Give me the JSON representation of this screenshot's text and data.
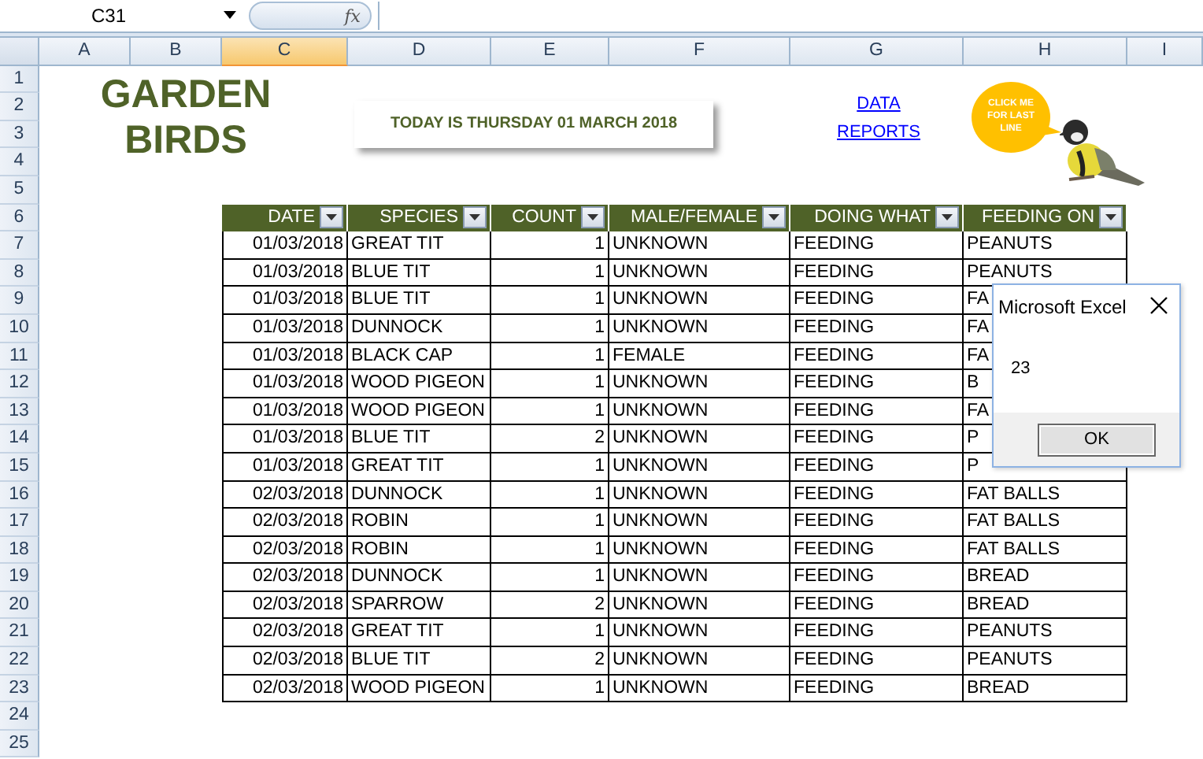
{
  "formula_bar": {
    "name_box": "C31",
    "function_icon": "fx"
  },
  "columns": [
    {
      "label": "A",
      "selected": false
    },
    {
      "label": "B",
      "selected": false
    },
    {
      "label": "C",
      "selected": true
    },
    {
      "label": "D",
      "selected": false
    },
    {
      "label": "E",
      "selected": false
    },
    {
      "label": "F",
      "selected": false
    },
    {
      "label": "G",
      "selected": false
    },
    {
      "label": "H",
      "selected": false
    },
    {
      "label": "I",
      "selected": false
    }
  ],
  "row_numbers": [
    "1",
    "2",
    "3",
    "4",
    "5",
    "6",
    "7",
    "8",
    "9",
    "10",
    "11",
    "12",
    "13",
    "14",
    "15",
    "16",
    "17",
    "18",
    "19",
    "20",
    "21",
    "22",
    "23",
    "24",
    "25"
  ],
  "title_lines": [
    "GARDEN",
    "BIRDS"
  ],
  "date_banner": "TODAY IS THURSDAY 01 MARCH 2018",
  "links": [
    "DATA",
    "REPORTS"
  ],
  "callout": "CLICK ME FOR LAST LINE",
  "table": {
    "columns": [
      "DATE",
      "SPECIES",
      "COUNT",
      "MALE/FEMALE",
      "DOING WHAT",
      "FEEDING ON"
    ],
    "rows": [
      [
        "01/03/2018",
        "GREAT TIT",
        "1",
        "UNKNOWN",
        "FEEDING",
        "PEANUTS"
      ],
      [
        "01/03/2018",
        "BLUE TIT",
        "1",
        "UNKNOWN",
        "FEEDING",
        "PEANUTS"
      ],
      [
        "01/03/2018",
        "BLUE TIT",
        "1",
        "UNKNOWN",
        "FEEDING",
        "FA"
      ],
      [
        "01/03/2018",
        "DUNNOCK",
        "1",
        "UNKNOWN",
        "FEEDING",
        "FA"
      ],
      [
        "01/03/2018",
        "BLACK CAP",
        "1",
        "FEMALE",
        "FEEDING",
        "FA"
      ],
      [
        "01/03/2018",
        "WOOD PIGEON",
        "1",
        "UNKNOWN",
        "FEEDING",
        "B"
      ],
      [
        "01/03/2018",
        "WOOD PIGEON",
        "1",
        "UNKNOWN",
        "FEEDING",
        "FA"
      ],
      [
        "01/03/2018",
        "BLUE TIT",
        "2",
        "UNKNOWN",
        "FEEDING",
        "P"
      ],
      [
        "01/03/2018",
        "GREAT TIT",
        "1",
        "UNKNOWN",
        "FEEDING",
        "P"
      ],
      [
        "02/03/2018",
        "DUNNOCK",
        "1",
        "UNKNOWN",
        "FEEDING",
        "FAT BALLS"
      ],
      [
        "02/03/2018",
        "ROBIN",
        "1",
        "UNKNOWN",
        "FEEDING",
        "FAT BALLS"
      ],
      [
        "02/03/2018",
        "ROBIN",
        "1",
        "UNKNOWN",
        "FEEDING",
        "FAT BALLS"
      ],
      [
        "02/03/2018",
        "DUNNOCK",
        "1",
        "UNKNOWN",
        "FEEDING",
        "BREAD"
      ],
      [
        "02/03/2018",
        "SPARROW",
        "2",
        "UNKNOWN",
        "FEEDING",
        "BREAD"
      ],
      [
        "02/03/2018",
        "GREAT TIT",
        "1",
        "UNKNOWN",
        "FEEDING",
        "PEANUTS"
      ],
      [
        "02/03/2018",
        "BLUE TIT",
        "2",
        "UNKNOWN",
        "FEEDING",
        "PEANUTS"
      ],
      [
        "02/03/2018",
        "WOOD PIGEON",
        "1",
        "UNKNOWN",
        "FEEDING",
        "BREAD"
      ]
    ]
  },
  "dialog": {
    "title": "Microsoft Excel",
    "message": "23",
    "button": "OK"
  }
}
